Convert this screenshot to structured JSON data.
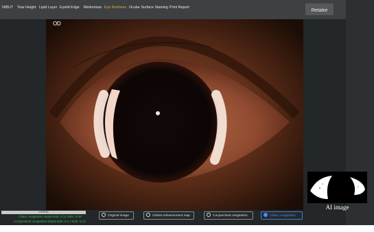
{
  "tabs": [
    {
      "label": "NIBUT",
      "active": false
    },
    {
      "label": "Tear Height",
      "active": false
    },
    {
      "label": "Lipid Layer",
      "active": false
    },
    {
      "label": "Eyelid Edge",
      "active": false
    },
    {
      "label": "Meibomian",
      "active": false
    },
    {
      "label": "Eye Redness",
      "active": true
    },
    {
      "label": "Ocular Surface Staining",
      "active": false
    },
    {
      "label": "Print Report",
      "active": false
    }
  ],
  "retake_label": "Retake",
  "eye_side": "OD",
  "ai_label": "AI image",
  "result": {
    "title": "Result",
    "ciliary": "Ciliary congestion Nasal side: 0.11  Side: 0.00",
    "conjunctival": "Conjunctival congestion Nasal side: 0.1 / Side: 0.12"
  },
  "options": [
    {
      "label": "Original image",
      "selected": false
    },
    {
      "label": "Global enhancement map",
      "selected": false
    },
    {
      "label": "Conjunctival congestion",
      "selected": false
    },
    {
      "label": "Ciliary congestion",
      "selected": true
    }
  ],
  "colors": {
    "accent_tab": "#e6a531",
    "selected_option": "#4a8ff0",
    "result_text": "#35c44a"
  }
}
